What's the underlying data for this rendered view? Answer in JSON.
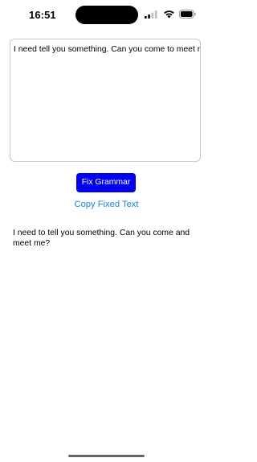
{
  "status_bar": {
    "time": "16:51"
  },
  "editor": {
    "value": "I need tell you something. Can you come to meet me"
  },
  "actions": {
    "fix_label": "Fix Grammar",
    "copy_label": "Copy Fixed Text"
  },
  "result": {
    "text": "I need to tell you something. Can you come and meet me?"
  },
  "colors": {
    "accent_button": "#0000ee",
    "link": "#1a84e0",
    "editor_border": "#c8c8cc"
  },
  "icons": {
    "cellular": "cellular-signal-icon",
    "wifi": "wifi-icon",
    "battery": "battery-icon"
  }
}
